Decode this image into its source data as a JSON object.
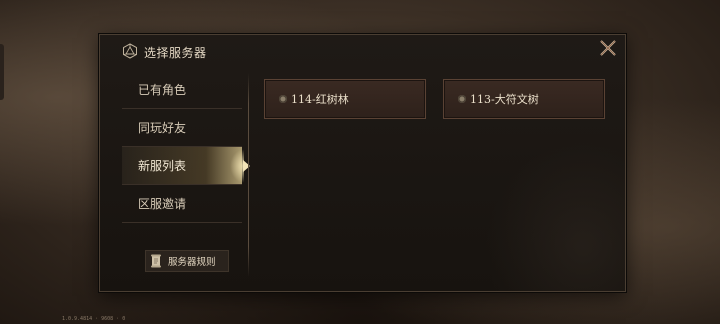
{
  "dialog": {
    "title": "选择服务器",
    "icon": "d20-dice-icon",
    "close_icon": "close-x-icon"
  },
  "sidebar": {
    "tabs": [
      {
        "label": "已有角色",
        "active": false
      },
      {
        "label": "同玩好友",
        "active": false
      },
      {
        "label": "新服列表",
        "active": true
      },
      {
        "label": "区服邀请",
        "active": false
      }
    ],
    "rules_button": {
      "label": "服务器规则",
      "icon": "scroll-icon"
    }
  },
  "servers": [
    {
      "name": "114-红树林",
      "status_icon": "gear-icon"
    },
    {
      "name": "113-大符文树",
      "status_icon": "gear-icon"
    }
  ],
  "footer": {
    "version": "1.0.9.4814 · 9608 · 0"
  },
  "colors": {
    "accent": "#f3e4b8",
    "card": "#3a2a22",
    "panel": "#1f1a16"
  }
}
